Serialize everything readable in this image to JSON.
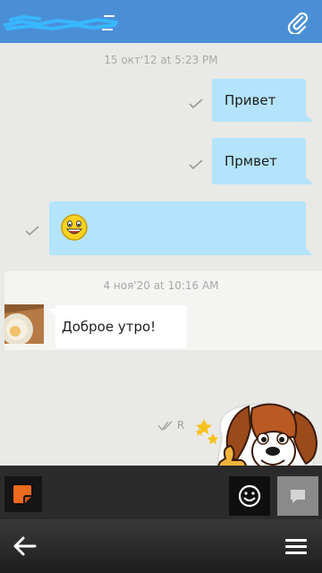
{
  "header": {
    "title": "",
    "attach_icon": "paperclip-icon",
    "background": "#4a8fd6"
  },
  "messages": {
    "date_1": "15 окт'12 at 5:23 PM",
    "out_1": "Привет",
    "out_2": "Прмвет",
    "out_3_emoji": "grinning-face-icon",
    "date_2": "4 ноя'20 at 10:16 AM",
    "in_1": "Доброе утро!",
    "read_mark": "R",
    "sticker": "thumbs-up-dog-sticker"
  },
  "colors": {
    "outgoing_bubble": "#b3e4fb",
    "incoming_bubble": "#ffffff",
    "chat_background": "#e9e9e6"
  },
  "input_bar": {
    "sticker_icon": "sticker-icon",
    "emoji_icon": "smiley-icon",
    "send_icon": "speech-bubble-icon"
  },
  "nav": {
    "back_icon": "back-arrow-icon",
    "menu_icon": "hamburger-menu-icon"
  }
}
